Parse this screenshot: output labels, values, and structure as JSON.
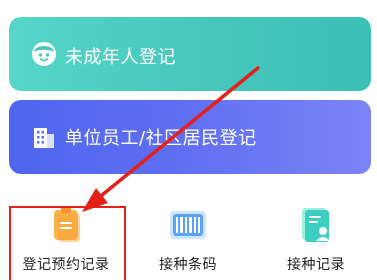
{
  "cards": {
    "minor_registration": {
      "label": "未成年人登记",
      "icon": "child-face-icon",
      "color": "#47c7bc"
    },
    "unit_registration": {
      "label": "单位员工/社区居民登记",
      "icon": "building-icon",
      "color": "#5e6ef2"
    }
  },
  "grid": {
    "appointment_record": {
      "label": "登记预约记录",
      "icon": "clipboard-icon"
    },
    "vaccination_barcode": {
      "label": "接种条码",
      "icon": "barcode-icon"
    },
    "vaccination_record": {
      "label": "接种记录",
      "icon": "document-person-icon"
    }
  },
  "annotation": {
    "highlight_color": "#e32119"
  }
}
